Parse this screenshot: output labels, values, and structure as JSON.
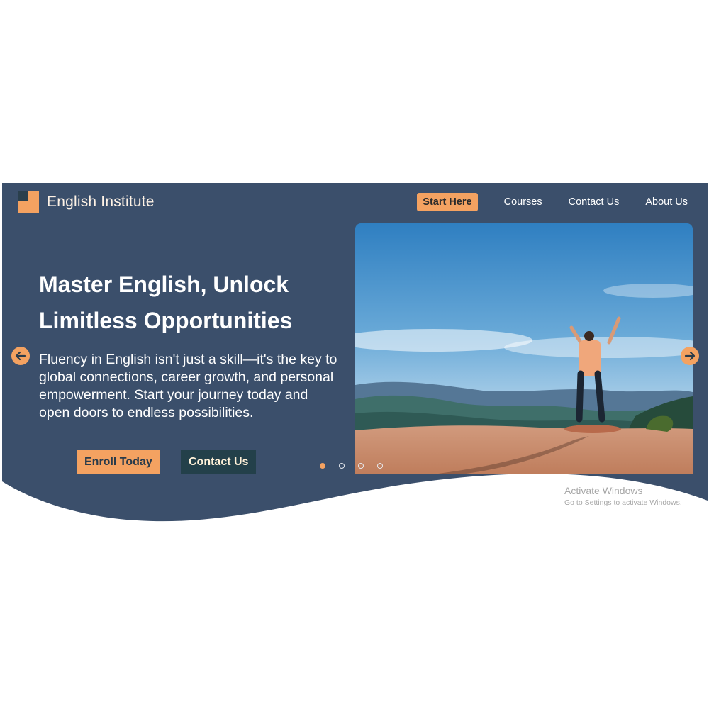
{
  "brand": {
    "name": "English Institute"
  },
  "nav": {
    "start_here": "Start Here",
    "courses": "Courses",
    "contact_us": "Contact Us",
    "about_us": "About Us"
  },
  "hero": {
    "headline": "Master English, Unlock Limitless Opportunities",
    "description": "Fluency in English isn't just a skill—it's the key to global connections, career growth, and personal empowerment. Start your journey today and open doors to endless possibilities.",
    "enroll_button": "Enroll Today",
    "contact_button": "Contact Us"
  },
  "carousel": {
    "slide_count": 4,
    "active_slide": 1,
    "image_description_icon": "person-on-mountain-photo",
    "prev_icon": "arrow-left-icon",
    "next_icon": "arrow-right-icon"
  },
  "watermark": {
    "title": "Activate Windows",
    "subtitle": "Go to Settings to activate Windows."
  },
  "colors": {
    "background": "#3b4f6b",
    "accent": "#f4a261",
    "dark_button": "#23404a"
  }
}
